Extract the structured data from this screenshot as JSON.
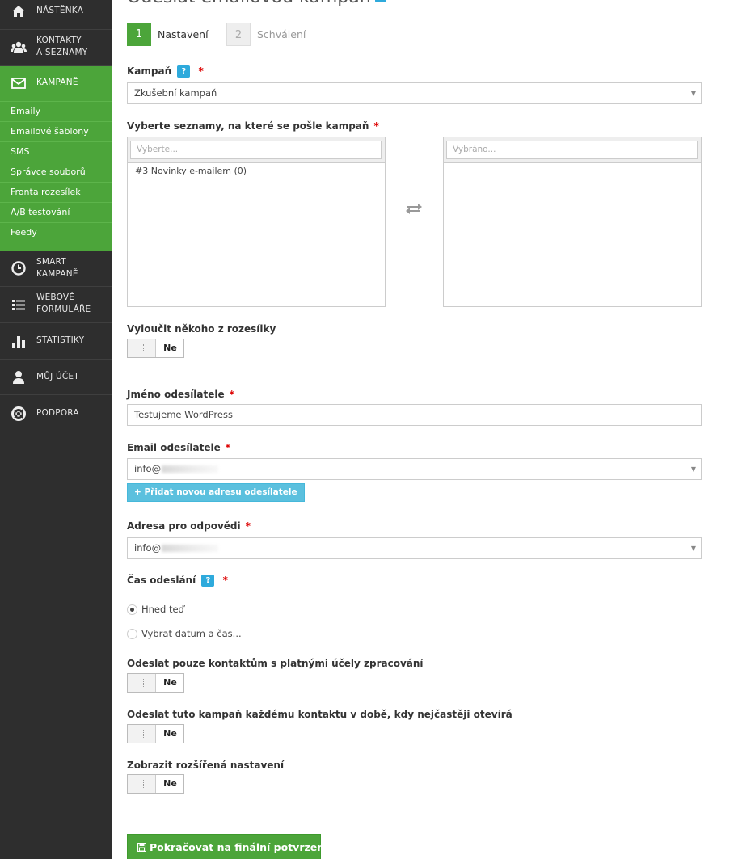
{
  "page": {
    "title": "Odeslat emailovou kampaň"
  },
  "sidebar": {
    "items": [
      {
        "label": "NÁSTĚNKA",
        "icon": "home-icon"
      },
      {
        "label": "KONTAKTY\nA SEZNAMY",
        "icon": "users-icon"
      },
      {
        "label": "KAMPANĚ",
        "icon": "envelope-icon",
        "active": true
      },
      {
        "label": "SMART\nKAMPANĚ",
        "icon": "clock-icon"
      },
      {
        "label": "WEBOVÉ\nFORMULÁŘE",
        "icon": "list-icon"
      },
      {
        "label": "STATISTIKY",
        "icon": "bar-chart-icon"
      },
      {
        "label": "MŮJ ÚČET",
        "icon": "user-icon"
      },
      {
        "label": "PODPORA",
        "icon": "lifebuoy-icon"
      }
    ],
    "subitems": [
      "Emaily",
      "Emailové šablony",
      "SMS",
      "Správce souborů",
      "Fronta rozesílek",
      "A/B testování",
      "Feedy"
    ]
  },
  "steps": [
    {
      "number": "1",
      "label": "Nastavení"
    },
    {
      "number": "2",
      "label": "Schválení"
    }
  ],
  "form": {
    "campaign": {
      "label": "Kampaň",
      "help": "?",
      "required": "*",
      "value": "Zkušební kampaň"
    },
    "lists": {
      "label": "Vyberte seznamy, na které se pošle kampaň",
      "required": "*",
      "available_placeholder": "Vyberte...",
      "selected_placeholder": "Vybráno...",
      "available_items": [
        "#3 Novinky e-mailem (0)"
      ]
    },
    "exclude": {
      "label": "Vyloučit někoho z rozesílky",
      "value": "Ne"
    },
    "sender_name": {
      "label": "Jméno odesílatele",
      "required": "*",
      "value": "Testujeme WordPress"
    },
    "sender_email": {
      "label": "Email odesílatele",
      "required": "*",
      "value": "info@"
    },
    "add_sender_button": "+ Přidat novou adresu odesílatele",
    "reply_to": {
      "label": "Adresa pro odpovědi",
      "required": "*",
      "value": "info@"
    },
    "send_time": {
      "label": "Čas odeslání",
      "help": "?",
      "required": "*",
      "options": [
        "Hned teď",
        "Vybrat datum a čas..."
      ],
      "selected": "Hned teď"
    },
    "valid_purposes": {
      "label": "Odeslat pouze kontaktům s platnými účely zpracování",
      "value": "Ne"
    },
    "best_time": {
      "label": "Odeslat tuto kampaň každému kontaktu v době, kdy nejčastěji otevírá",
      "value": "Ne"
    },
    "advanced": {
      "label": "Zobrazit rozšířená nastavení",
      "value": "Ne"
    },
    "submit_button": "Pokračovat na finální potvrzení"
  },
  "colors": {
    "accent_green": "#4ca53a",
    "sidebar_bg": "#2e2e2e",
    "info_blue": "#5bc0de",
    "required_red": "#dd0000"
  }
}
